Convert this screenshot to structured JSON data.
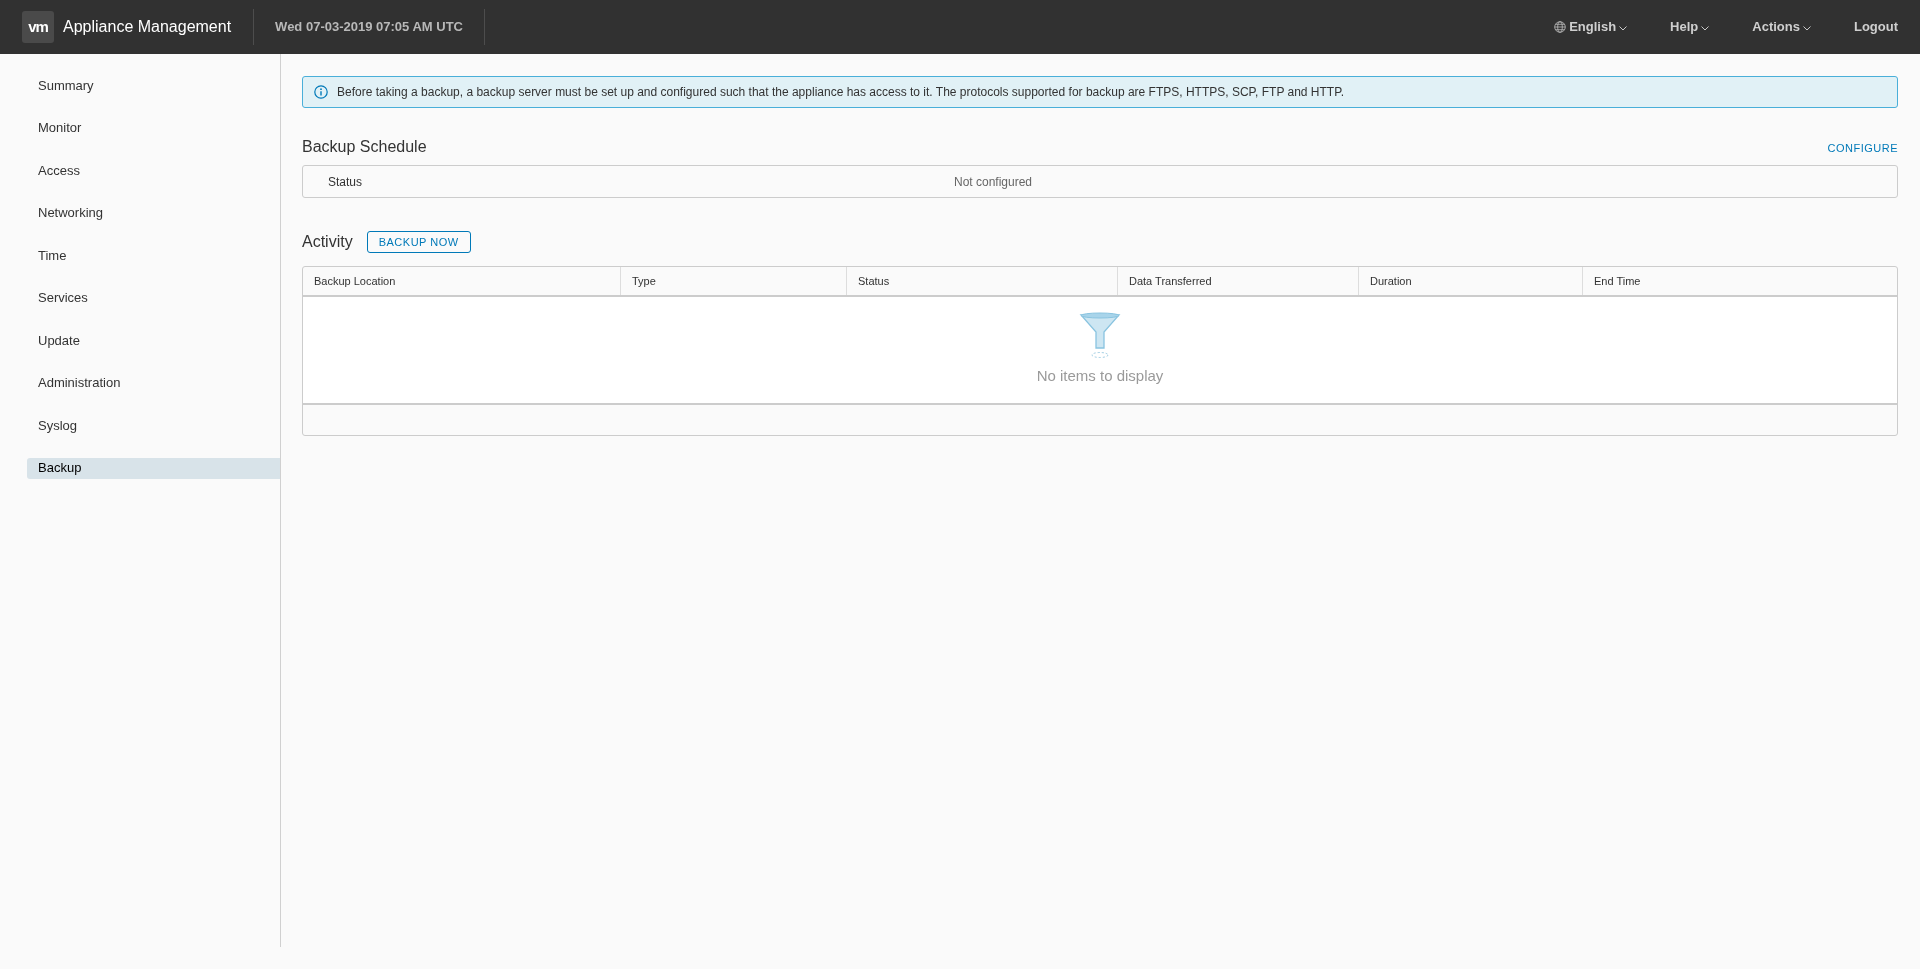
{
  "header": {
    "logo": "vm",
    "title": "Appliance Management",
    "datetime": "Wed 07-03-2019 07:05 AM UTC",
    "menus": [
      {
        "label": "English",
        "kind": "language"
      },
      {
        "label": "Help",
        "kind": "dropdown"
      },
      {
        "label": "Actions",
        "kind": "dropdown"
      },
      {
        "label": "Logout",
        "kind": "link"
      }
    ]
  },
  "sidebar": {
    "items": [
      {
        "label": "Summary",
        "selected": false
      },
      {
        "label": "Monitor",
        "selected": false
      },
      {
        "label": "Access",
        "selected": false
      },
      {
        "label": "Networking",
        "selected": false
      },
      {
        "label": "Time",
        "selected": false
      },
      {
        "label": "Services",
        "selected": false
      },
      {
        "label": "Update",
        "selected": false
      },
      {
        "label": "Administration",
        "selected": false
      },
      {
        "label": "Syslog",
        "selected": false
      },
      {
        "label": "Backup",
        "selected": true
      }
    ]
  },
  "alert": {
    "text": "Before taking a backup, a backup server must be set up and configured such that the appliance has access to it. The protocols supported for backup are FTPS, HTTPS, SCP, FTP and HTTP."
  },
  "backup_schedule": {
    "title": "Backup Schedule",
    "action": "CONFIGURE",
    "rows": [
      {
        "label": "Status",
        "value": "Not configured"
      }
    ]
  },
  "activity": {
    "title": "Activity",
    "action": "BACKUP NOW",
    "table": {
      "columns": [
        "Backup Location",
        "Type",
        "Status",
        "Data Transferred",
        "Duration",
        "End Time"
      ],
      "empty_text": "No items to display"
    }
  }
}
